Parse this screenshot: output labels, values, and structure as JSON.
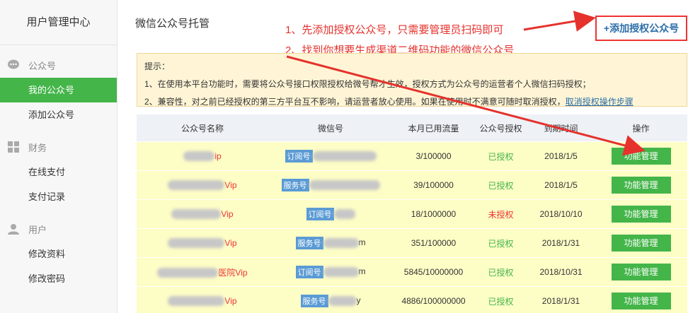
{
  "sidebar": {
    "title": "用户管理中心",
    "groups": [
      {
        "label": "公众号",
        "icon": "chat-bubble-icon",
        "items": [
          {
            "label": "我的公众号",
            "active": true
          },
          {
            "label": "添加公众号",
            "active": false
          }
        ]
      },
      {
        "label": "财务",
        "icon": "grid-icon",
        "items": [
          {
            "label": "在线支付",
            "active": false
          },
          {
            "label": "支付记录",
            "active": false
          }
        ]
      },
      {
        "label": "用户",
        "icon": "user-icon",
        "items": [
          {
            "label": "修改资料",
            "active": false
          },
          {
            "label": "修改密码",
            "active": false
          }
        ]
      }
    ]
  },
  "main": {
    "title": "微信公众号托管",
    "add_button": "+添加授权公众号",
    "annotations": [
      "1、先添加授权公众号，只需要管理员扫码即可",
      "2、找到你想要生成渠道二维码功能的微信公众号"
    ],
    "notice": {
      "heading": "提示：",
      "line1": "1、在使用本平台功能时，需要将公众号接口权限授权给微号帮才生效，授权方式为公众号的运营者个人微信扫码授权；",
      "line2": "2、兼容性，对之前已经授权的第三方平台互不影响，请运营者放心使用。如果在使用时不满意可随时取消授权，",
      "link": "取消授权操作步骤"
    }
  },
  "table": {
    "headers": [
      "公众号名称",
      "微信号",
      "本月已用流量",
      "公众号授权",
      "到期时间",
      "操作"
    ],
    "rows": [
      {
        "name_suffix": "ip",
        "tag": "订阅号",
        "wx_suffix": "",
        "usage": "3/100000",
        "auth": "已授权",
        "auth_ok": true,
        "expire": "2018/1/5",
        "action": "功能管理"
      },
      {
        "name_suffix": "Vip",
        "tag": "服务号",
        "wx_suffix": "",
        "usage": "39/100000",
        "auth": "已授权",
        "auth_ok": true,
        "expire": "2018/1/5",
        "action": "功能管理"
      },
      {
        "name_suffix": "Vip",
        "tag": "订阅号",
        "wx_suffix": "",
        "usage": "18/1000000",
        "auth": "未授权",
        "auth_ok": false,
        "expire": "2018/10/10",
        "action": "功能管理"
      },
      {
        "name_suffix": "Vip",
        "tag": "服务号",
        "wx_suffix": "m",
        "usage": "351/100000",
        "auth": "已授权",
        "auth_ok": true,
        "expire": "2018/1/31",
        "action": "功能管理"
      },
      {
        "name_suffix": "医院Vip",
        "tag": "订阅号",
        "wx_suffix": "m",
        "usage": "5845/10000000",
        "auth": "已授权",
        "auth_ok": true,
        "expire": "2018/10/31",
        "action": "功能管理"
      },
      {
        "name_suffix": "Vip",
        "tag": "服务号",
        "wx_suffix": "y",
        "usage": "4886/100000000",
        "auth": "已授权",
        "auth_ok": true,
        "expire": "2018/1/31",
        "action": "功能管理"
      }
    ]
  },
  "colors": {
    "accent": "#44b549",
    "annotation": "#e5322d",
    "link": "#2c6ea8",
    "notice_bg": "#fff5d6",
    "row_bg": "#fdfdc6"
  }
}
